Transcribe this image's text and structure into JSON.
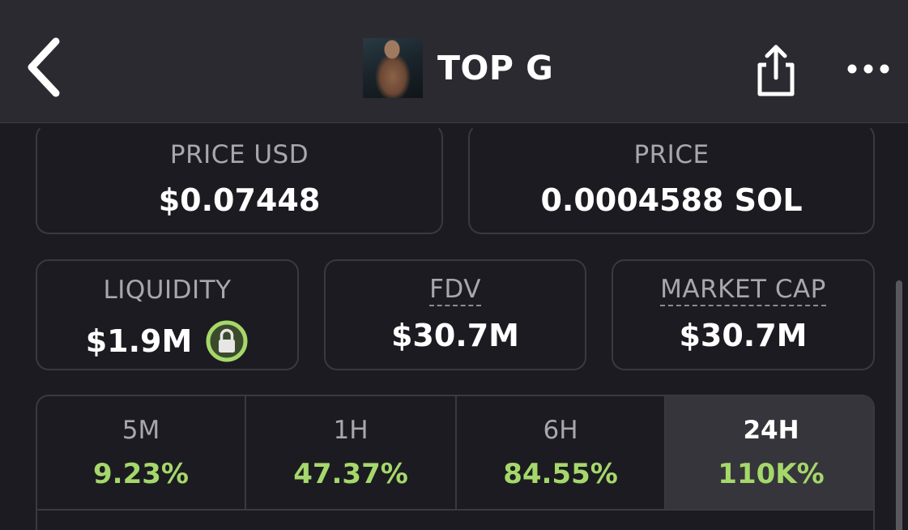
{
  "header": {
    "title": "TOP G",
    "icons": {
      "back": "chevron-left-icon",
      "share": "share-icon",
      "more": "more-horizontal-icon"
    }
  },
  "price_usd": {
    "label": "PRICE USD",
    "value": "$0.07448"
  },
  "price_native": {
    "label": "PRICE",
    "value": "0.0004588 SOL"
  },
  "liquidity": {
    "label": "LIQUIDITY",
    "value": "$1.9M",
    "lock_icon": "lock-icon"
  },
  "fdv": {
    "label": "FDV",
    "value": "$30.7M"
  },
  "market_cap": {
    "label": "MARKET CAP",
    "value": "$30.7M"
  },
  "timeframes": [
    {
      "label": "5M",
      "change": "9.23%"
    },
    {
      "label": "1H",
      "change": "47.37%"
    },
    {
      "label": "6H",
      "change": "84.55%"
    },
    {
      "label": "24H",
      "change": "110K%",
      "selected": true
    }
  ],
  "colors": {
    "background": "#1c1b21",
    "header": "#2b2a30",
    "border": "#3a3940",
    "label": "#a8a7ad",
    "positive": "#a5d86b",
    "active_tab": "#36353b"
  }
}
